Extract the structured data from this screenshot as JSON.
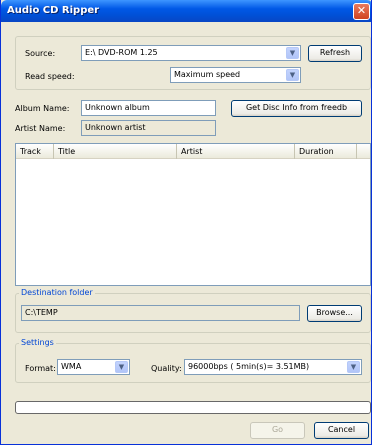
{
  "window": {
    "title": "Audio CD Ripper",
    "close_glyph": "✕"
  },
  "source": {
    "label": "Source:",
    "value": "E:\\ DVD-ROM 1.25",
    "refresh_label": "Refresh"
  },
  "read_speed": {
    "label": "Read speed:",
    "value": "Maximum speed"
  },
  "album": {
    "label": "Album Name:",
    "value": "Unknown album",
    "freedb_label": "Get Disc Info from freedb"
  },
  "artist": {
    "label": "Artist Name:",
    "value": "Unknown artist"
  },
  "tracks": {
    "columns": [
      "Track",
      "Title",
      "Artist",
      "Duration"
    ],
    "rows": []
  },
  "destination": {
    "title": "Destination folder",
    "path": "C:\\TEMP",
    "browse_label": "Browse..."
  },
  "settings": {
    "title": "Settings",
    "format_label": "Format:",
    "format_value": "WMA",
    "quality_label": "Quality:",
    "quality_value": "96000bps ( 5min(s)= 3.51MB)"
  },
  "progress": {
    "value": 0
  },
  "footer": {
    "go_label": "Go",
    "cancel_label": "Cancel"
  },
  "icons": {
    "dropdown": "chevron-down-icon",
    "close": "close-icon"
  }
}
